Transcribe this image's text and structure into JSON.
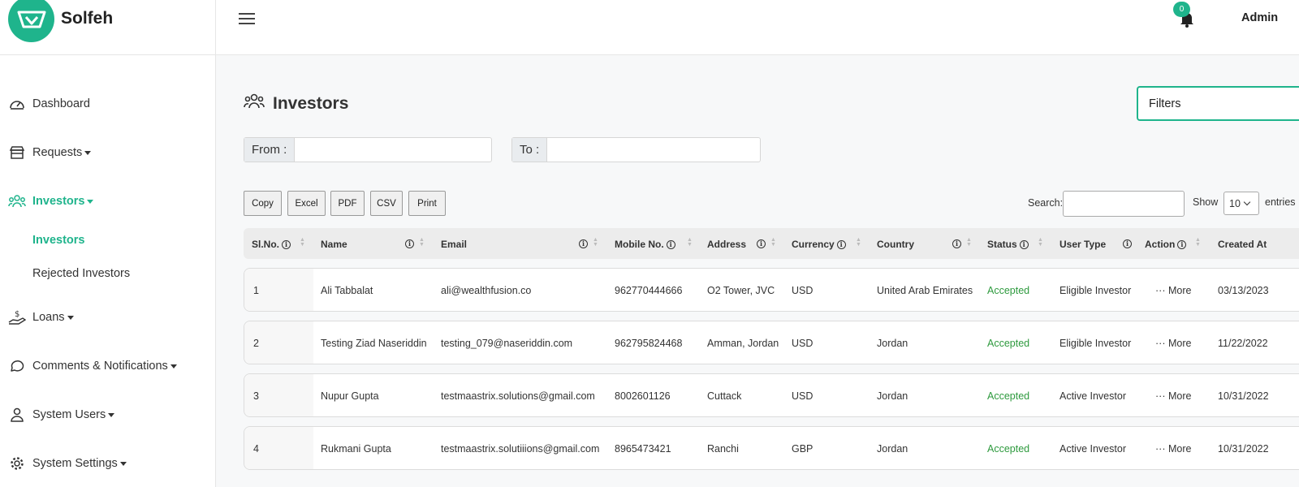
{
  "brand": {
    "name": "Solfeh"
  },
  "topbar": {
    "notification_count": "0",
    "user": "Admin"
  },
  "sidebar": {
    "dashboard": "Dashboard",
    "requests": "Requests",
    "investors": "Investors",
    "sub_investors": "Investors",
    "sub_rejected": "Rejected Investors",
    "loans": "Loans",
    "comments": "Comments & Notifications",
    "system_users": "System Users",
    "system_settings": "System Settings"
  },
  "page": {
    "title": "Investors",
    "filters": "Filters"
  },
  "date_range": {
    "from_label": "From :",
    "to_label": "To :"
  },
  "export_buttons": {
    "copy": "Copy",
    "excel": "Excel",
    "pdf": "PDF",
    "csv": "CSV",
    "print": "Print"
  },
  "table_controls": {
    "search_label": "Search:",
    "show_label": "Show",
    "show_value": "10",
    "entries_label": "entries"
  },
  "table": {
    "columns": [
      "Sl.No.",
      "Name",
      "Email",
      "Mobile No.",
      "Address",
      "Currency",
      "Country",
      "Status",
      "User Type",
      "Action",
      "Created At"
    ],
    "rows": [
      {
        "sl": "1",
        "name": "Ali Tabbalat",
        "email": "ali@wealthfusion.co",
        "mobile": "962770444666",
        "address": "O2 Tower, JVC",
        "currency": "USD",
        "country": "United Arab Emirates",
        "status": "Accepted",
        "user_type": "Eligible Investor",
        "action": "··· More",
        "created": "03/13/2023"
      },
      {
        "sl": "2",
        "name": "Testing Ziad Naseriddin",
        "email": "testing_079@naseriddin.com",
        "mobile": "962795824468",
        "address": "Amman, Jordan",
        "currency": "USD",
        "country": "Jordan",
        "status": "Accepted",
        "user_type": "Eligible Investor",
        "action": "··· More",
        "created": "11/22/2022"
      },
      {
        "sl": "3",
        "name": "Nupur Gupta",
        "email": "testmaastrix.solutions@gmail.com",
        "mobile": "8002601126",
        "address": "Cuttack",
        "currency": "USD",
        "country": "Jordan",
        "status": "Accepted",
        "user_type": "Active Investor",
        "action": "··· More",
        "created": "10/31/2022"
      },
      {
        "sl": "4",
        "name": "Rukmani Gupta",
        "email": "testmaastrix.solutiiions@gmail.com",
        "mobile": "8965473421",
        "address": "Ranchi",
        "currency": "GBP",
        "country": "Jordan",
        "status": "Accepted",
        "user_type": "Active Investor",
        "action": "··· More",
        "created": "10/31/2022"
      }
    ]
  },
  "colors": {
    "accent": "#1fb48c",
    "status_accepted": "#2e9a3e"
  }
}
